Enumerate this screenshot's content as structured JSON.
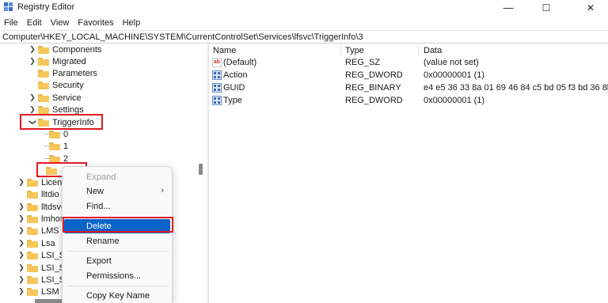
{
  "window": {
    "title": "Registry Editor",
    "minimize_glyph": "—",
    "maximize_glyph": "☐",
    "close_glyph": "✕"
  },
  "menu": [
    "File",
    "Edit",
    "View",
    "Favorites",
    "Help"
  ],
  "address": "Computer\\HKEY_LOCAL_MACHINE\\SYSTEM\\CurrentControlSet\\Services\\lfsvc\\TriggerInfo\\3",
  "tree": {
    "items": [
      {
        "label": "Components"
      },
      {
        "label": "Migrated"
      },
      {
        "label": "Parameters"
      },
      {
        "label": "Security"
      },
      {
        "label": "Service"
      },
      {
        "label": "Settings"
      },
      {
        "label": "TriggerInfo"
      },
      {
        "label": "0"
      },
      {
        "label": "1"
      },
      {
        "label": "2"
      },
      {
        "label": ""
      },
      {
        "label": "License"
      },
      {
        "label": "lltdio"
      },
      {
        "label": "lltdsvc"
      },
      {
        "label": "lmhos"
      },
      {
        "label": "LMS"
      },
      {
        "label": "Lsa"
      },
      {
        "label": "LSI_SA"
      },
      {
        "label": "LSI_SA"
      },
      {
        "label": "LSI_SA"
      },
      {
        "label": "LSM"
      }
    ]
  },
  "values": {
    "columns": [
      "Name",
      "Type",
      "Data"
    ],
    "rows": [
      {
        "name": "(Default)",
        "type": "REG_SZ",
        "data": "(value not set)",
        "icon": "string-value-icon"
      },
      {
        "name": "Action",
        "type": "REG_DWORD",
        "data": "0x00000001 (1)",
        "icon": "binary-value-icon"
      },
      {
        "name": "GUID",
        "type": "REG_BINARY",
        "data": "e4 e5 36 33 8a 01 69 46 84 c5 bd 05 f3 bd 36 8b",
        "icon": "binary-value-icon"
      },
      {
        "name": "Type",
        "type": "REG_DWORD",
        "data": "0x00000001 (1)",
        "icon": "binary-value-icon"
      }
    ]
  },
  "context_menu": {
    "items": [
      {
        "label": "Expand",
        "state": "disabled"
      },
      {
        "label": "New",
        "submenu": "›"
      },
      {
        "label": "Find..."
      },
      {
        "label": "Delete",
        "state": "selected"
      },
      {
        "label": "Rename"
      },
      {
        "label": "Export"
      },
      {
        "label": "Permissions..."
      },
      {
        "label": "Copy Key Name"
      }
    ]
  },
  "colors": {
    "highlight_box": "#e01a22",
    "menu_selection": "#0a63c9",
    "folder": "#f5c75a"
  }
}
